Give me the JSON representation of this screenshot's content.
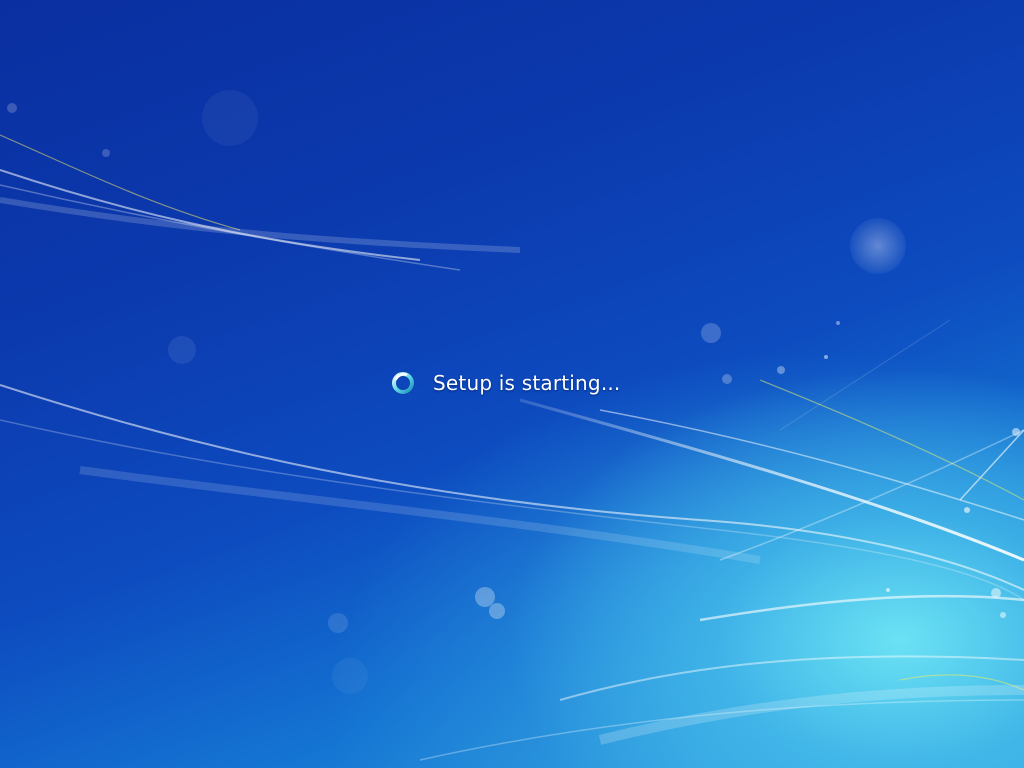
{
  "screen": {
    "status_text": "Setup is starting..."
  },
  "icons": {
    "spinner": "busy-spinner-icon"
  },
  "colors": {
    "background_dark": "#0a2fa0",
    "background_light": "#6ee6f5",
    "text": "#ffffff"
  }
}
